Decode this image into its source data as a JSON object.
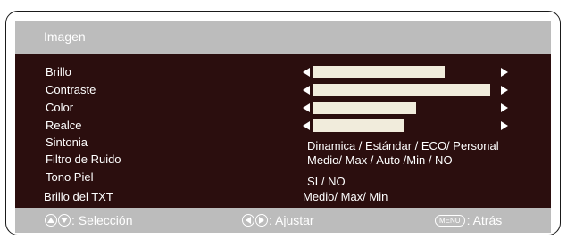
{
  "header": {
    "title": "Imagen"
  },
  "rows": [
    {
      "label": "Brillo",
      "level": 0.74
    },
    {
      "label": "Contraste",
      "level": 1.0
    },
    {
      "label": "Color",
      "level": 0.58
    },
    {
      "label": "Realce",
      "level": 0.51
    },
    {
      "label": "Sintonia",
      "value": "Dinamica / Estándar / ECO/ Personal"
    },
    {
      "label": "Filtro de Ruido",
      "value": "Medio/ Max / Auto /Min  / NO"
    },
    {
      "label": "Tono Piel",
      "value": "SI / NO"
    },
    {
      "label": "Brillo del TXT",
      "value": "Medio/ Max/ Min"
    }
  ],
  "footer": {
    "select_label": ": Selección",
    "adjust_label": ": Ajustar",
    "menu_badge": "MENU",
    "back_label": ": Atrás"
  },
  "colors": {
    "menu_background": "#2b0e0e",
    "header_footer": "#bcbcbc",
    "slider_fill": "#f1ecdc",
    "text": "#ffffff"
  },
  "icons": [
    "up-down-arrows-icon",
    "left-right-arrows-icon",
    "menu-button-icon",
    "slider-left-arrow-icon",
    "slider-right-arrow-icon"
  ]
}
